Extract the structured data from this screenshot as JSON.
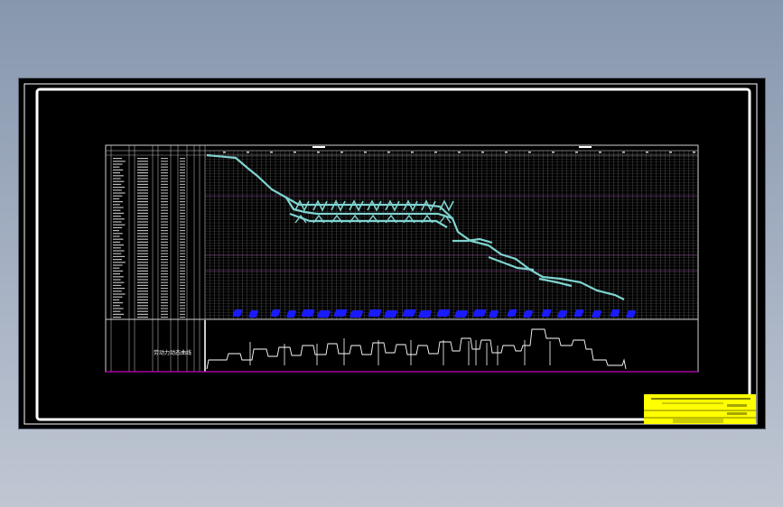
{
  "drawing": {
    "background": "#000000",
    "frame_color": "#ffffff",
    "grid_color": "#9a9a9a",
    "network_color": "#7fd4d0",
    "milestone_color": "#1a1aff",
    "resource_line_color": "#ffffff",
    "baseline_color": "#c000c0",
    "title_block_color": "#ffff00",
    "resource_section_label": "劳动力动态曲线",
    "icons": [
      "selection-cursor-icon"
    ]
  }
}
